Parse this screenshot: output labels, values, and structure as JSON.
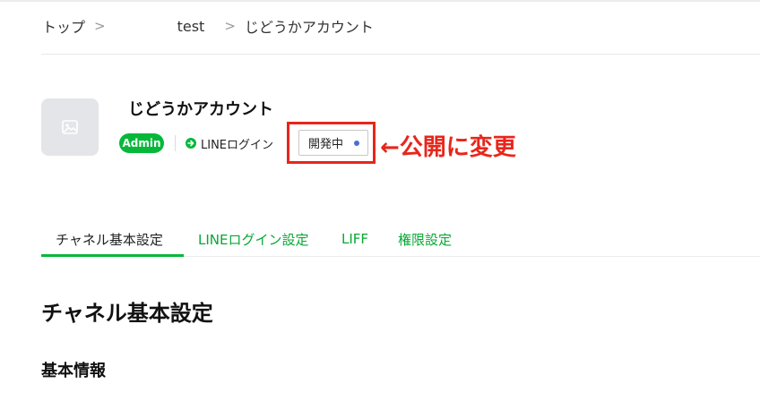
{
  "breadcrumb": {
    "items": [
      "トップ",
      "test",
      "じどうかアカウント"
    ],
    "separator": ">"
  },
  "channel": {
    "name": "じどうかアカウント",
    "role_badge": "Admin",
    "login_type": "LINEログイン",
    "status": "開発中"
  },
  "annotation": {
    "text": "←公開に変更"
  },
  "tabs": [
    {
      "label": "チャネル基本設定",
      "active": true
    },
    {
      "label": "LINEログイン設定",
      "active": false
    },
    {
      "label": "LIFF",
      "active": false
    },
    {
      "label": "権限設定",
      "active": false
    }
  ],
  "main": {
    "section_title": "チャネル基本設定",
    "subsection_title": "基本情報"
  },
  "colors": {
    "brand_green": "#06b83a",
    "annotation_red": "#e8261b",
    "status_dot": "#4a6fd0"
  }
}
